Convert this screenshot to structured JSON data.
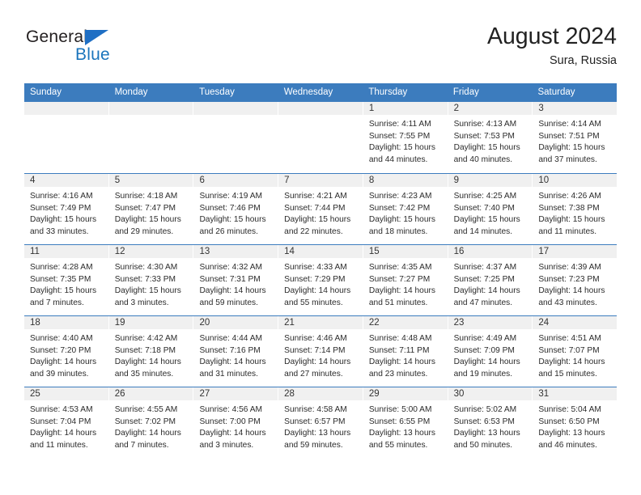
{
  "brand": {
    "name_top": "General",
    "name_bottom": "Blue",
    "triangle_color": "#1f6fc4",
    "blue_color": "#1b75bc"
  },
  "header": {
    "title": "August 2024",
    "subtitle": "Sura, Russia"
  },
  "theme": {
    "header_row_bg": "#3c7cbe",
    "day_band_bg": "#f0f0f0",
    "row_divider": "#3c7cbe",
    "text": "#2b2b2b"
  },
  "weekdays": [
    "Sunday",
    "Monday",
    "Tuesday",
    "Wednesday",
    "Thursday",
    "Friday",
    "Saturday"
  ],
  "weeks": [
    [
      {
        "day": "",
        "lines": []
      },
      {
        "day": "",
        "lines": []
      },
      {
        "day": "",
        "lines": []
      },
      {
        "day": "",
        "lines": []
      },
      {
        "day": "1",
        "lines": [
          "Sunrise: 4:11 AM",
          "Sunset: 7:55 PM",
          "Daylight: 15 hours",
          "and 44 minutes."
        ]
      },
      {
        "day": "2",
        "lines": [
          "Sunrise: 4:13 AM",
          "Sunset: 7:53 PM",
          "Daylight: 15 hours",
          "and 40 minutes."
        ]
      },
      {
        "day": "3",
        "lines": [
          "Sunrise: 4:14 AM",
          "Sunset: 7:51 PM",
          "Daylight: 15 hours",
          "and 37 minutes."
        ]
      }
    ],
    [
      {
        "day": "4",
        "lines": [
          "Sunrise: 4:16 AM",
          "Sunset: 7:49 PM",
          "Daylight: 15 hours",
          "and 33 minutes."
        ]
      },
      {
        "day": "5",
        "lines": [
          "Sunrise: 4:18 AM",
          "Sunset: 7:47 PM",
          "Daylight: 15 hours",
          "and 29 minutes."
        ]
      },
      {
        "day": "6",
        "lines": [
          "Sunrise: 4:19 AM",
          "Sunset: 7:46 PM",
          "Daylight: 15 hours",
          "and 26 minutes."
        ]
      },
      {
        "day": "7",
        "lines": [
          "Sunrise: 4:21 AM",
          "Sunset: 7:44 PM",
          "Daylight: 15 hours",
          "and 22 minutes."
        ]
      },
      {
        "day": "8",
        "lines": [
          "Sunrise: 4:23 AM",
          "Sunset: 7:42 PM",
          "Daylight: 15 hours",
          "and 18 minutes."
        ]
      },
      {
        "day": "9",
        "lines": [
          "Sunrise: 4:25 AM",
          "Sunset: 7:40 PM",
          "Daylight: 15 hours",
          "and 14 minutes."
        ]
      },
      {
        "day": "10",
        "lines": [
          "Sunrise: 4:26 AM",
          "Sunset: 7:38 PM",
          "Daylight: 15 hours",
          "and 11 minutes."
        ]
      }
    ],
    [
      {
        "day": "11",
        "lines": [
          "Sunrise: 4:28 AM",
          "Sunset: 7:35 PM",
          "Daylight: 15 hours",
          "and 7 minutes."
        ]
      },
      {
        "day": "12",
        "lines": [
          "Sunrise: 4:30 AM",
          "Sunset: 7:33 PM",
          "Daylight: 15 hours",
          "and 3 minutes."
        ]
      },
      {
        "day": "13",
        "lines": [
          "Sunrise: 4:32 AM",
          "Sunset: 7:31 PM",
          "Daylight: 14 hours",
          "and 59 minutes."
        ]
      },
      {
        "day": "14",
        "lines": [
          "Sunrise: 4:33 AM",
          "Sunset: 7:29 PM",
          "Daylight: 14 hours",
          "and 55 minutes."
        ]
      },
      {
        "day": "15",
        "lines": [
          "Sunrise: 4:35 AM",
          "Sunset: 7:27 PM",
          "Daylight: 14 hours",
          "and 51 minutes."
        ]
      },
      {
        "day": "16",
        "lines": [
          "Sunrise: 4:37 AM",
          "Sunset: 7:25 PM",
          "Daylight: 14 hours",
          "and 47 minutes."
        ]
      },
      {
        "day": "17",
        "lines": [
          "Sunrise: 4:39 AM",
          "Sunset: 7:23 PM",
          "Daylight: 14 hours",
          "and 43 minutes."
        ]
      }
    ],
    [
      {
        "day": "18",
        "lines": [
          "Sunrise: 4:40 AM",
          "Sunset: 7:20 PM",
          "Daylight: 14 hours",
          "and 39 minutes."
        ]
      },
      {
        "day": "19",
        "lines": [
          "Sunrise: 4:42 AM",
          "Sunset: 7:18 PM",
          "Daylight: 14 hours",
          "and 35 minutes."
        ]
      },
      {
        "day": "20",
        "lines": [
          "Sunrise: 4:44 AM",
          "Sunset: 7:16 PM",
          "Daylight: 14 hours",
          "and 31 minutes."
        ]
      },
      {
        "day": "21",
        "lines": [
          "Sunrise: 4:46 AM",
          "Sunset: 7:14 PM",
          "Daylight: 14 hours",
          "and 27 minutes."
        ]
      },
      {
        "day": "22",
        "lines": [
          "Sunrise: 4:48 AM",
          "Sunset: 7:11 PM",
          "Daylight: 14 hours",
          "and 23 minutes."
        ]
      },
      {
        "day": "23",
        "lines": [
          "Sunrise: 4:49 AM",
          "Sunset: 7:09 PM",
          "Daylight: 14 hours",
          "and 19 minutes."
        ]
      },
      {
        "day": "24",
        "lines": [
          "Sunrise: 4:51 AM",
          "Sunset: 7:07 PM",
          "Daylight: 14 hours",
          "and 15 minutes."
        ]
      }
    ],
    [
      {
        "day": "25",
        "lines": [
          "Sunrise: 4:53 AM",
          "Sunset: 7:04 PM",
          "Daylight: 14 hours",
          "and 11 minutes."
        ]
      },
      {
        "day": "26",
        "lines": [
          "Sunrise: 4:55 AM",
          "Sunset: 7:02 PM",
          "Daylight: 14 hours",
          "and 7 minutes."
        ]
      },
      {
        "day": "27",
        "lines": [
          "Sunrise: 4:56 AM",
          "Sunset: 7:00 PM",
          "Daylight: 14 hours",
          "and 3 minutes."
        ]
      },
      {
        "day": "28",
        "lines": [
          "Sunrise: 4:58 AM",
          "Sunset: 6:57 PM",
          "Daylight: 13 hours",
          "and 59 minutes."
        ]
      },
      {
        "day": "29",
        "lines": [
          "Sunrise: 5:00 AM",
          "Sunset: 6:55 PM",
          "Daylight: 13 hours",
          "and 55 minutes."
        ]
      },
      {
        "day": "30",
        "lines": [
          "Sunrise: 5:02 AM",
          "Sunset: 6:53 PM",
          "Daylight: 13 hours",
          "and 50 minutes."
        ]
      },
      {
        "day": "31",
        "lines": [
          "Sunrise: 5:04 AM",
          "Sunset: 6:50 PM",
          "Daylight: 13 hours",
          "and 46 minutes."
        ]
      }
    ]
  ]
}
